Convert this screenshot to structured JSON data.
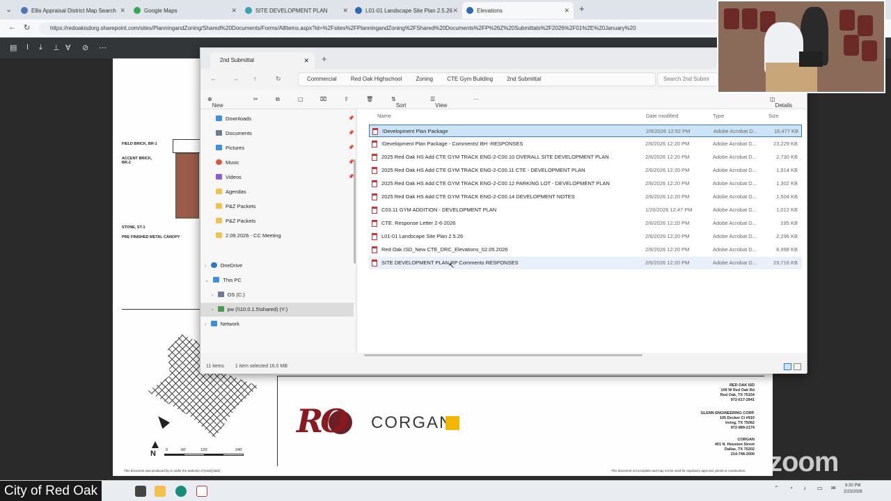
{
  "browser": {
    "tabs": [
      {
        "label": "Ellis Appraisal District Map Search",
        "icon": "globe-icon"
      },
      {
        "label": "Google Maps",
        "icon": "maps-icon"
      },
      {
        "label": "SITE DEVELOPMENT PLAN",
        "icon": "pdf-icon"
      },
      {
        "label": "L01-01 Landscape Site Plan 2.5.26",
        "icon": "pdf-icon"
      },
      {
        "label": "Elevations",
        "icon": "pdf-icon"
      }
    ],
    "new_tab": "+",
    "url": "https://redoakisdorg.sharepoint.com/sites/PlanningandZoning/Shared%20Documents/Forms/AllItems.aspx?id=%2Fsites%2FPlanningandZoning%2FShared%20Documents%2FP%26Z%20Submittals%2F2026%2F01%2E%20January%20"
  },
  "explorer": {
    "tab_title": "2nd Submittal",
    "breadcrumbs": [
      "Commercial",
      "Red Oak Highschool",
      "Zoning",
      "CTE Gym Building",
      "2nd Submittal"
    ],
    "search_placeholder": "Search 2nd Submi",
    "commands": {
      "new": "New",
      "sort": "Sort",
      "view": "View",
      "more": "···",
      "details": "Details"
    },
    "sidebar": [
      {
        "label": "Downloads",
        "icon": "download-icon",
        "color": "#3a8ee6",
        "pinned": true
      },
      {
        "label": "Documents",
        "icon": "document-icon",
        "color": "#6b7c93",
        "pinned": true
      },
      {
        "label": "Pictures",
        "icon": "picture-icon",
        "color": "#3a8ee6",
        "pinned": true
      },
      {
        "label": "Music",
        "icon": "music-icon",
        "color": "#e0583a",
        "pinned": true
      },
      {
        "label": "Videos",
        "icon": "video-icon",
        "color": "#8e5ad6",
        "pinned": true
      },
      {
        "label": "Agendas",
        "icon": "folder-icon",
        "color": "#f2c14e",
        "pinned": false
      },
      {
        "label": "P&Z Packets",
        "icon": "folder-icon",
        "color": "#f2c14e",
        "pinned": false
      },
      {
        "label": "P&Z Packets",
        "icon": "folder-icon",
        "color": "#f2c14e",
        "pinned": false
      },
      {
        "label": "2.09.2026 - CC Meeting",
        "icon": "folder-icon",
        "color": "#f2c14e",
        "pinned": false
      }
    ],
    "tree": [
      {
        "label": "OneDrive",
        "icon": "cloud-icon",
        "color": "#2f79c9"
      },
      {
        "label": "This PC",
        "icon": "pc-icon",
        "color": "#3a8ee6"
      },
      {
        "label": "OS (C:)",
        "icon": "drive-icon",
        "color": "#6b7c93"
      },
      {
        "label": "pw (\\\\10.0.1.5\\shared) (Y:)",
        "icon": "network-drive-icon",
        "color": "#4d9a4d"
      },
      {
        "label": "Network",
        "icon": "network-icon",
        "color": "#3a8ee6"
      }
    ],
    "columns": {
      "name": "Name",
      "date": "Date modified",
      "type": "Type",
      "size": "Size"
    },
    "files": [
      {
        "name": "!Development Plan Package",
        "date": "2/6/2026 12:52 PM",
        "type": "Adobe Acrobat D...",
        "size": "16,477 KB"
      },
      {
        "name": "!Development Plan Package - Comments! BH -RESPONSES",
        "date": "2/6/2026 12:20 PM",
        "type": "Adobe Acrobat D...",
        "size": "23,229 KB"
      },
      {
        "name": "2025 Red Oak HS Add CTE GYM TRACK ENG-2-C00.10 OVERALL SITE DEVELOPMENT PLAN",
        "date": "2/6/2026 12:20 PM",
        "type": "Adobe Acrobat D...",
        "size": "2,730 KB"
      },
      {
        "name": "2025 Red Oak HS Add CTE GYM TRACK ENG-2-C00.11 CTE - DEVELOPMENT PLAN",
        "date": "2/6/2026 12:20 PM",
        "type": "Adobe Acrobat D...",
        "size": "1,914 KB"
      },
      {
        "name": "2025 Red Oak HS Add CTE GYM TRACK ENG-2-C00.12 PARKING LOT - DEVELOPMENT PLAN",
        "date": "2/6/2026 12:20 PM",
        "type": "Adobe Acrobat D...",
        "size": "1,302 KB"
      },
      {
        "name": "2025 Red Oak HS Add CTE GYM TRACK ENG-2-C00.14 DEVELOPMENT NOTES",
        "date": "2/6/2026 12:20 PM",
        "type": "Adobe Acrobat D...",
        "size": "1,504 KB"
      },
      {
        "name": "C03.11 GYM ADDITION - DEVELOPMENT PLAN",
        "date": "1/20/2026 12:47 PM",
        "type": "Adobe Acrobat D...",
        "size": "1,012 KB"
      },
      {
        "name": "CTE. Response Letter 2-6-2026",
        "date": "2/6/2026 12:20 PM",
        "type": "Adobe Acrobat D...",
        "size": "195 KB"
      },
      {
        "name": "L01-01 Landscape Site Plan 2.5.26",
        "date": "2/6/2026 12:20 PM",
        "type": "Adobe Acrobat D...",
        "size": "2,296 KB"
      },
      {
        "name": "Red Oak ISD_New CTE_DRC_Elevations_02.05.2026",
        "date": "2/6/2026 12:20 PM",
        "type": "Adobe Acrobat D...",
        "size": "8,998 KB"
      },
      {
        "name": "SITE DEVELOPMENT PLAN RP Comments RESPONSES",
        "date": "2/6/2026 12:20 PM",
        "type": "Adobe Acrobat D...",
        "size": "23,716 KB"
      }
    ],
    "status": {
      "count": "11 items",
      "selected": "1 item selected  16.0 MB"
    }
  },
  "drawing": {
    "labels": {
      "field_brick": "FIELD BRICK, BR-1",
      "accent_brick": "ACCENT BRICK, BR-2",
      "stone": "STONE, ST-1",
      "canopy": "PRE FINISHED METAL CANOPY"
    },
    "north": "N",
    "scale_ticks": [
      "0",
      "60'",
      "120'",
      "240'"
    ],
    "client": {
      "name": "RED OAK ISD",
      "lines": [
        "109 W Red Oak Rd",
        "Red Oak, TX 75154",
        "972-617-2941"
      ]
    },
    "engineer": {
      "name": "GLENN ENGINEERING CORP.",
      "lines": [
        "105 Decker Ct #910",
        "Irving, TX 75062",
        "972-989-2174"
      ]
    },
    "architect": {
      "name": "CORGAN",
      "lines": [
        "401 N. Houston Street",
        "Dallas, TX 75202",
        "214-748-2000"
      ]
    },
    "logo_ro": "RO",
    "logo_corgan": "CORGAN",
    "footnote_left": "This document was produced by or under the authority of [seal] [date]",
    "footnote_right": "This document is incomplete and may not be used for regulatory approval, permit or construction."
  },
  "taskbar": {
    "caption": "City of Red Oak",
    "time": "6:30 PM",
    "date": "2/23/2026"
  },
  "watermark": "zoom"
}
